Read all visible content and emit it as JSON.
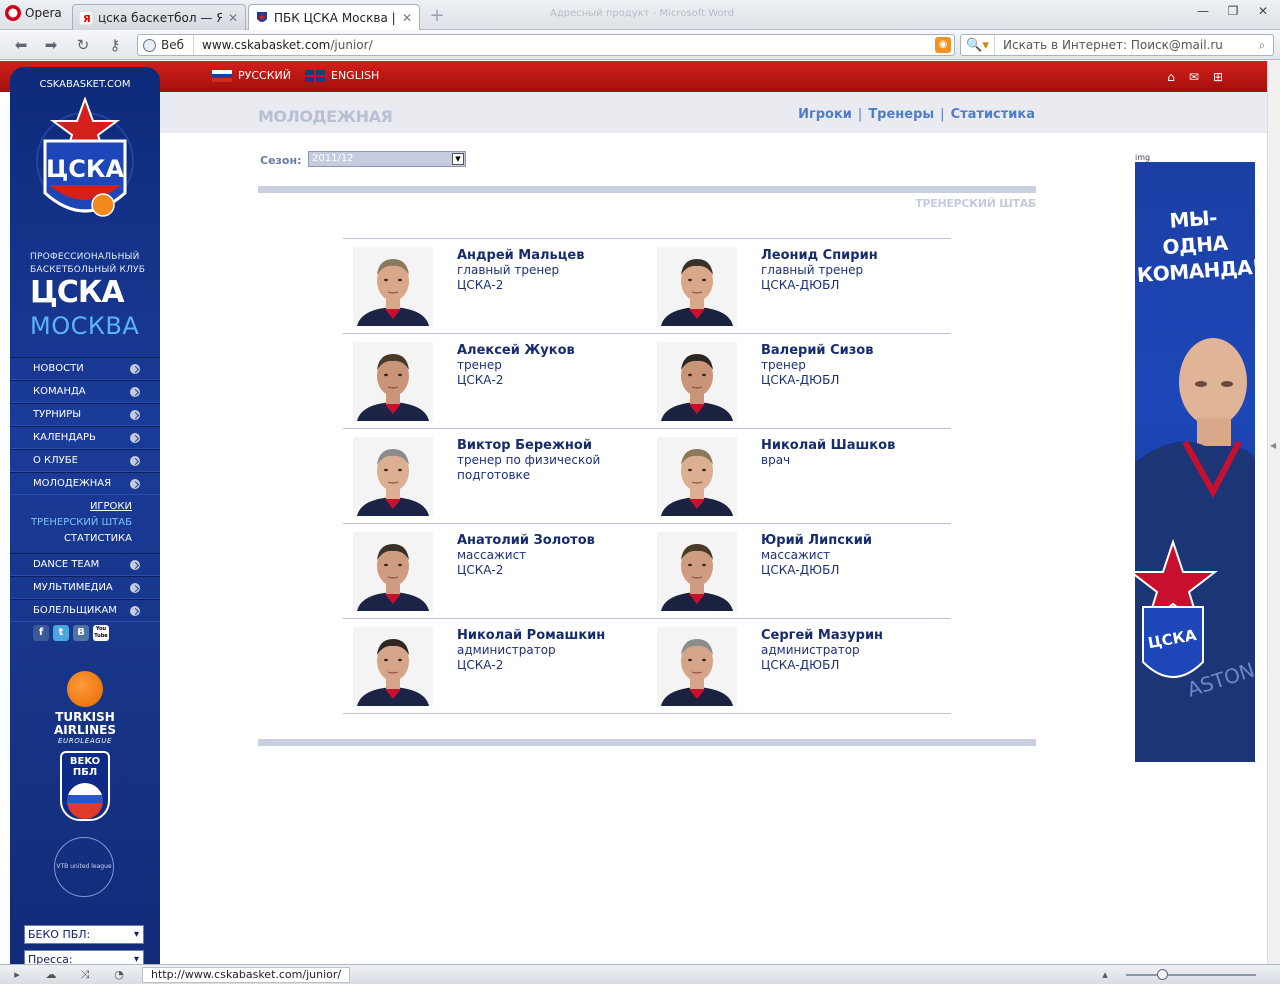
{
  "browser": {
    "menu_label": "Opera",
    "tabs": [
      {
        "title": "цска баскетбол — Янд...",
        "active": false
      },
      {
        "title": "ПБК ЦСКА Москва | Мо...",
        "active": true
      }
    ],
    "window_title": "Адресный продукт - Microsoft Word",
    "address": {
      "badge": "Веб",
      "url_domain": "www.cskabasket.com",
      "url_path": "/junior/"
    },
    "search_placeholder": "Искать в Интернет: Поиск@mail.ru",
    "status_url": "http://www.cskabasket.com/junior/",
    "zoom_level": 0.28
  },
  "topbar": {
    "languages": [
      {
        "code": "ru",
        "label": "РУССКИЙ"
      },
      {
        "code": "en",
        "label": "ENGLISH"
      }
    ],
    "icons": [
      "home-icon",
      "mail-icon",
      "sitemap-icon"
    ]
  },
  "sidebar": {
    "site_url": "CSKABASKET.COM",
    "emblem_text": "ЦСКА",
    "club_sub_line1": "ПРОФЕССИОНАЛЬНЫЙ",
    "club_sub_line2": "БАСКЕТБОЛЬНЫЙ КЛУБ",
    "club_name": "ЦСКА",
    "club_city": "МОСКВА",
    "menu_top": [
      "НОВОСТИ",
      "КОМАНДА",
      "ТУРНИРЫ",
      "КАЛЕНДАРЬ",
      "О КЛУБЕ",
      "МОЛОДЕЖНАЯ"
    ],
    "submenu": [
      "ИГРОКИ",
      "ТРЕНЕРСКИЙ ШТАБ",
      "СТАТИСТИКА"
    ],
    "menu_bottom": [
      "DANCE TEAM",
      "МУЛЬТИМЕДИА",
      "БОЛЕЛЬЩИКАМ"
    ],
    "social": [
      "f",
      "t",
      "В",
      "You Tube"
    ],
    "sponsor1_line1": "TURKISH",
    "sponsor1_line2": "AIRLINES",
    "sponsor1_line3": "EUROLEAGUE",
    "sponsor2_line1": "BEKO",
    "sponsor2_line2": "ПБЛ",
    "sponsor3": "VTB united league",
    "select1": "БЕКО ПБЛ:",
    "select2": "Пресса:"
  },
  "content": {
    "section_title": "МОЛОДЕЖНАЯ",
    "links": [
      "Игроки",
      "Тренеры",
      "Статистика"
    ],
    "season_label": "Сезон:",
    "season_value": "2011/12",
    "staff_heading": "ТРЕНЕРСКИЙ ШТАБ",
    "staff": [
      {
        "name": "Андрей Мальцев",
        "role": "главный тренер",
        "team": "ЦСКА-2"
      },
      {
        "name": "Леонид Спирин",
        "role": "главный тренер",
        "team": "ЦСКА-ДЮБЛ"
      },
      {
        "name": "Алексей Жуков",
        "role": "тренер",
        "team": "ЦСКА-2"
      },
      {
        "name": "Валерий Сизов",
        "role": "тренер",
        "team": "ЦСКА-ДЮБЛ"
      },
      {
        "name": "Виктор Бережной",
        "role": "тренер по физической",
        "team": "подготовке"
      },
      {
        "name": "Николай Шашков",
        "role": "врач",
        "team": ""
      },
      {
        "name": "Анатолий Золотов",
        "role": "массажист",
        "team": "ЦСКА-2"
      },
      {
        "name": "Юрий Липский",
        "role": "массажист",
        "team": "ЦСКА-ДЮБЛ"
      },
      {
        "name": "Николай Ромашкин",
        "role": "администратор",
        "team": "ЦСКА-2"
      },
      {
        "name": "Сергей Мазурин",
        "role": "администратор",
        "team": "ЦСКА-ДЮБЛ"
      }
    ]
  },
  "ad": {
    "label": "img",
    "line1": "МЫ-",
    "line2": "ОДНА",
    "line3": "КОМАНДА!",
    "jersey_text": "ЦСКА",
    "bottom_text": "ASTON"
  },
  "colors": {
    "accent_red": "#c0160f",
    "sidebar_blue": "#1a3b98",
    "link_blue": "#4f7ec9",
    "name_blue": "#162c6c"
  }
}
